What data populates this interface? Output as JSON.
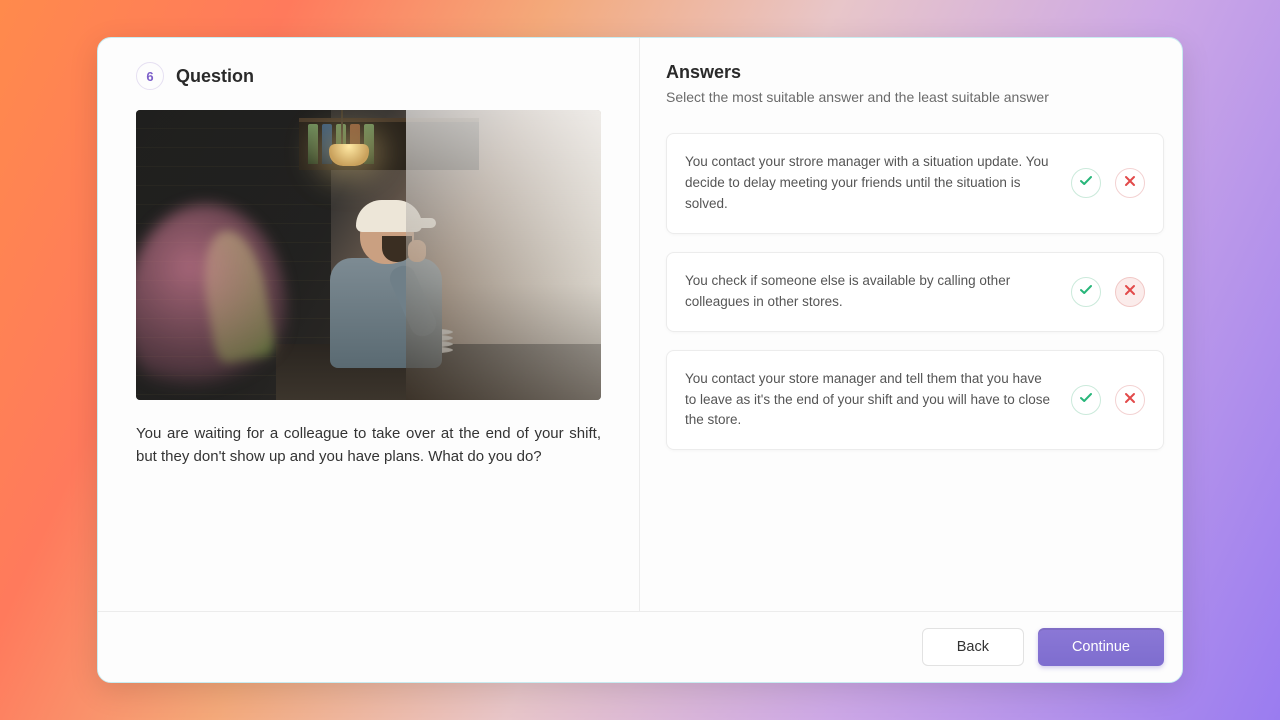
{
  "question": {
    "number": "6",
    "label": "Question",
    "text": "You are waiting for a colleague to take over at the end of your shift, but they don't show up and you have plans. What do you do?"
  },
  "answers_panel": {
    "title": "Answers",
    "subtitle": "Select the most suitable answer and the least suitable answer"
  },
  "answers": [
    {
      "text": "You contact your strore manager with a situation update. You decide to delay meeting your friends until the situation is solved.",
      "least_selected": false
    },
    {
      "text": "You check if someone else is available by calling other colleagues in other stores.",
      "least_selected": true
    },
    {
      "text": "You contact your store manager and tell them that you have to leave as it's the end of your shift and you will have to close the store.",
      "least_selected": false
    }
  ],
  "footer": {
    "back": "Back",
    "continue": "Continue"
  },
  "icons": {
    "check": "check-icon",
    "cross": "cross-icon"
  },
  "colors": {
    "accent": "#7e6dcf",
    "ok": "#28b67a",
    "no": "#e24a4a"
  }
}
